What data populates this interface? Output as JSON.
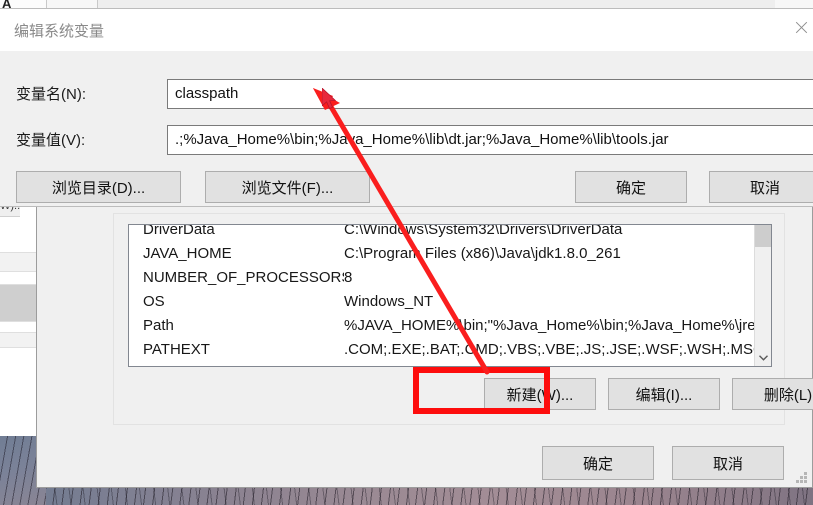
{
  "edit_dialog": {
    "title": "编辑系统变量",
    "close_icon": "close-icon",
    "name_label": "变量名(N):",
    "name_value": "classpath",
    "value_label": "变量值(V):",
    "value_value": ".;%Java_Home%\\bin;%Java_Home%\\lib\\dt.jar;%Java_Home%\\lib\\tools.jar",
    "browse_dir_label": "浏览目录(D)...",
    "browse_file_label": "浏览文件(F)...",
    "ok_label": "确定",
    "cancel_label": "取消"
  },
  "env_window": {
    "variables": [
      {
        "name": "DriverData",
        "value": "C:\\Windows\\System32\\Drivers\\DriverData"
      },
      {
        "name": "JAVA_HOME",
        "value": "C:\\Program Files (x86)\\Java\\jdk1.8.0_261"
      },
      {
        "name": "NUMBER_OF_PROCESSORS",
        "value": "8"
      },
      {
        "name": "OS",
        "value": "Windows_NT"
      },
      {
        "name": "Path",
        "value": "%JAVA_HOME%\\bin;\"%Java_Home%\\bin;%Java_Home%\\jre\\bin..."
      },
      {
        "name": "PATHEXT",
        "value": ".COM;.EXE;.BAT;.CMD;.VBS;.VBE;.JS;.JSE;.WSF;.WSH;.MSC"
      }
    ],
    "new_label": "新建(W)...",
    "edit_label": "编辑(I)...",
    "delete_label": "删除(L)",
    "ok_label": "确定",
    "cancel_label": "取消",
    "scroll_up_icon": "chevron-up-icon",
    "scroll_down_icon": "chevron-down-icon"
  },
  "annotation": {
    "arrow_color": "#fa1e1e",
    "highlight_color": "#fd0d0d",
    "arrow_from": "新建(W)...",
    "arrow_to": "变量名(N): classpath"
  },
  "background": {
    "peek_text": "W)..."
  }
}
